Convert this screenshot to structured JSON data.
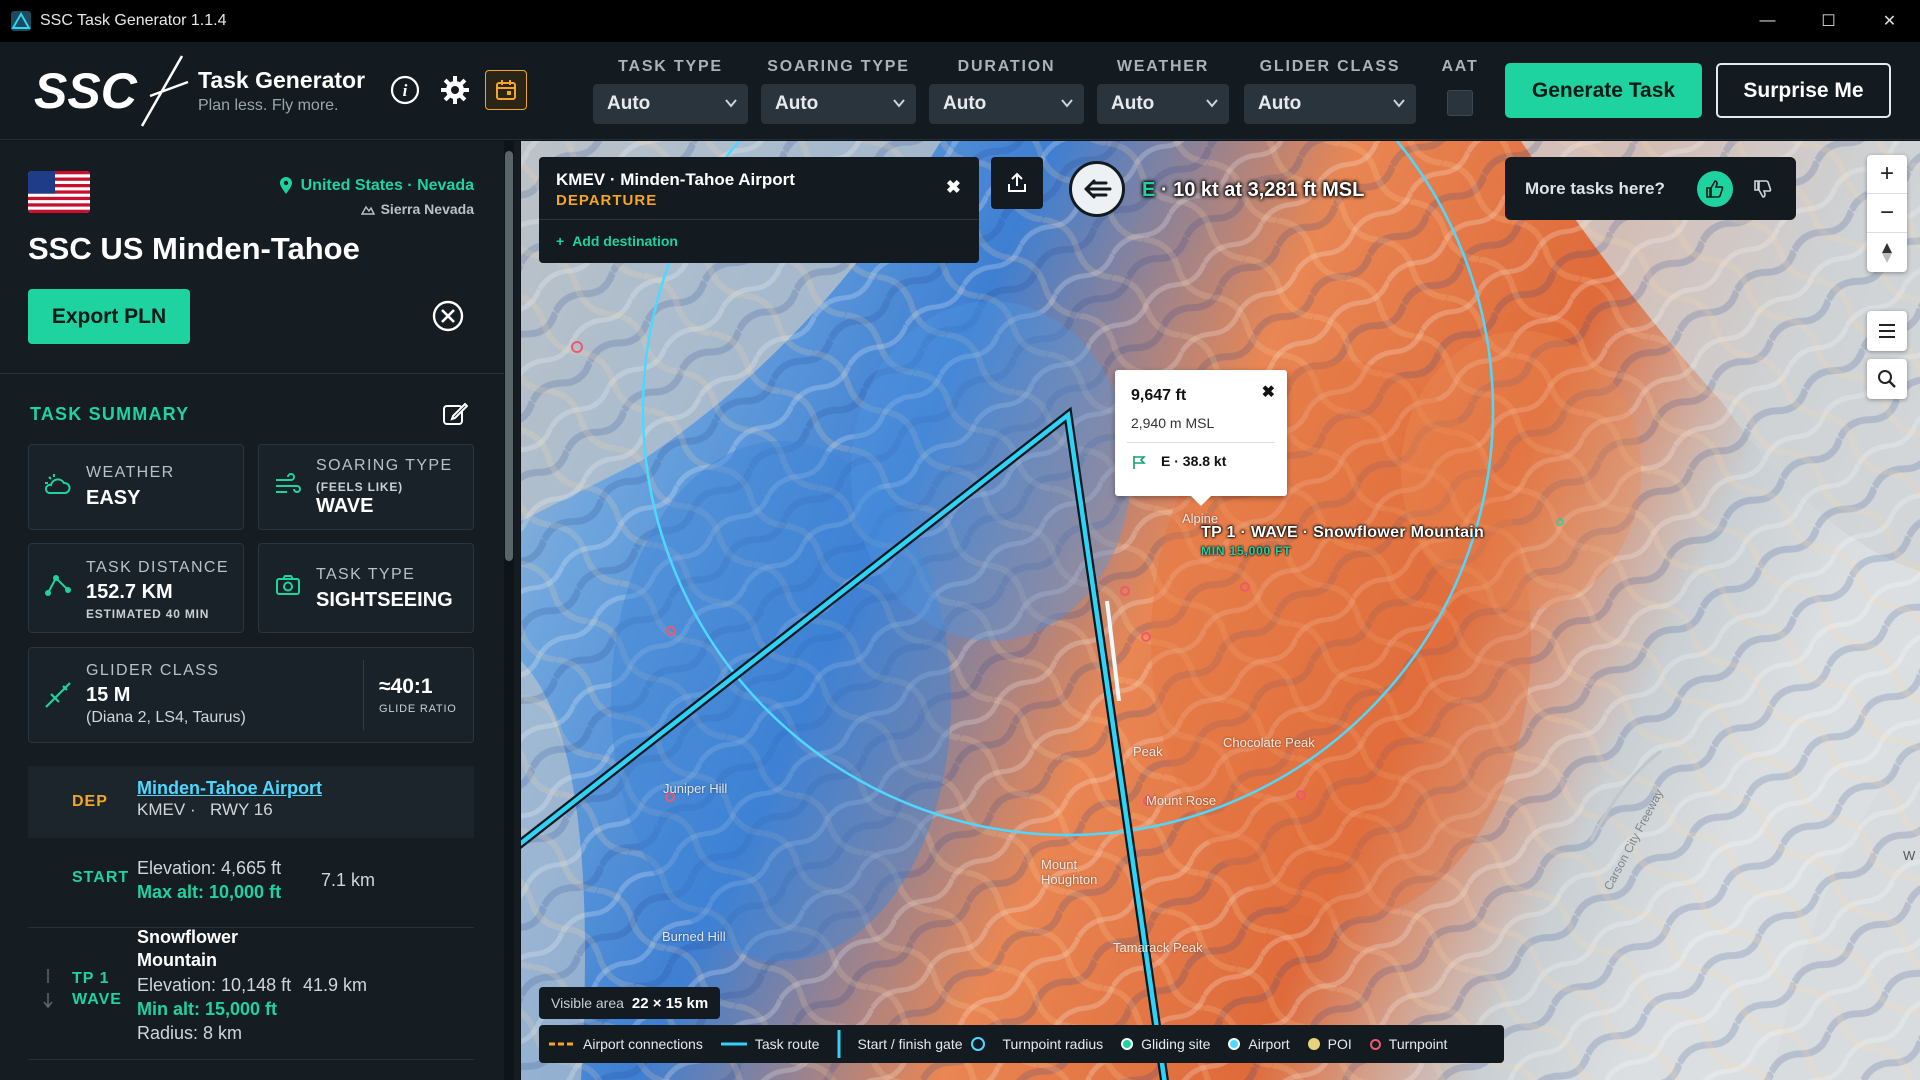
{
  "window": {
    "title": "SSC Task Generator 1.1.4",
    "minimize": "—",
    "maximize": "☐",
    "close": "✕"
  },
  "brand": {
    "logo_text": "SSC",
    "title": "Task Generator",
    "subtitle": "Plan less. Fly more."
  },
  "filters": [
    {
      "label": "TASK TYPE",
      "value": "Auto"
    },
    {
      "label": "SOARING TYPE",
      "value": "Auto"
    },
    {
      "label": "DURATION",
      "value": "Auto"
    },
    {
      "label": "WEATHER",
      "value": "Auto"
    },
    {
      "label": "GLIDER CLASS",
      "value": "Auto"
    }
  ],
  "aat": {
    "label": "AAT",
    "checked": false
  },
  "buttons": {
    "generate": "Generate Task",
    "surprise": "Surprise Me",
    "export": "Export PLN"
  },
  "location": {
    "country_region": "United States · Nevada",
    "area": "Sierra Nevada",
    "site": "SSC US Minden-Tahoe"
  },
  "summary": {
    "heading": "TASK SUMMARY",
    "weather": {
      "label": "WEATHER",
      "value": "EASY"
    },
    "soaring": {
      "label": "SOARING TYPE",
      "note": "(FEELS LIKE)",
      "value": "WAVE"
    },
    "distance": {
      "label": "TASK DISTANCE",
      "value": "152.7 KM",
      "note": "ESTIMATED 40 MIN"
    },
    "task_type": {
      "label": "TASK TYPE",
      "value": "SIGHTSEEING"
    },
    "glider": {
      "label": "GLIDER CLASS",
      "value": "15 M",
      "models": "(Diana 2, LS4, Taurus)",
      "ratio": "≈40:1",
      "ratio_label": "GLIDE RATIO"
    }
  },
  "legs": {
    "dep": {
      "code": "DEP",
      "name": "Minden-Tahoe Airport",
      "icao": "KMEV",
      "sep": "·",
      "rwy": "RWY 16"
    },
    "start": {
      "code": "START",
      "elevation": "Elevation: 4,665 ft",
      "max_alt": "Max alt: 10,000 ft",
      "dist": "7.1 km"
    },
    "tp1": {
      "code": "TP 1",
      "kind": "WAVE",
      "name_line1": "Snowflower",
      "name_line2": "Mountain",
      "elevation": "Elevation: 10,148 ft",
      "min_alt": "Min alt: 15,000 ft",
      "radius": "Radius: 8 km",
      "dist": "41.9 km"
    }
  },
  "map": {
    "departure_panel": {
      "name": "KMEV · Minden-Tahoe Airport",
      "role": "DEPARTURE",
      "add": "Add destination",
      "close": "✖"
    },
    "wind": {
      "dir": "E",
      "text": " · 10 kt at 3,281 ft MSL"
    },
    "more_tasks": "More tasks here?",
    "popup": {
      "ft": "9,647 ft",
      "m": "2,940 m MSL",
      "wind": "E · 38.8 kt",
      "close": "✖"
    },
    "tp_label": "TP 1 · WAVE · Snowflower Mountain",
    "tp_min": "MIN 15,000 FT",
    "places": [
      "Alpine",
      "Juniper Hill",
      "Chocolate Peak",
      "Peak",
      "Mount Rose",
      "Burned Hill",
      "Mount Houghton",
      "Tamarack Peak",
      "Carson City Freeway",
      "W"
    ],
    "visible_area": {
      "label": "Visible area",
      "value": "22 × 15 km"
    },
    "legend": {
      "airport_connections": "Airport connections",
      "task_route": "Task route",
      "start_finish": "Start / finish gate",
      "turnpoint_radius": "Turnpoint radius",
      "gliding_site": "Gliding site",
      "airport": "Airport",
      "poi": "POI",
      "turnpoint": "Turnpoint"
    },
    "zoom_in": "+",
    "zoom_out": "−"
  },
  "colors": {
    "accent": "#1fd3a0",
    "route": "#2ed3f5",
    "departure": "#f5a623",
    "link": "#4fd8ff"
  }
}
